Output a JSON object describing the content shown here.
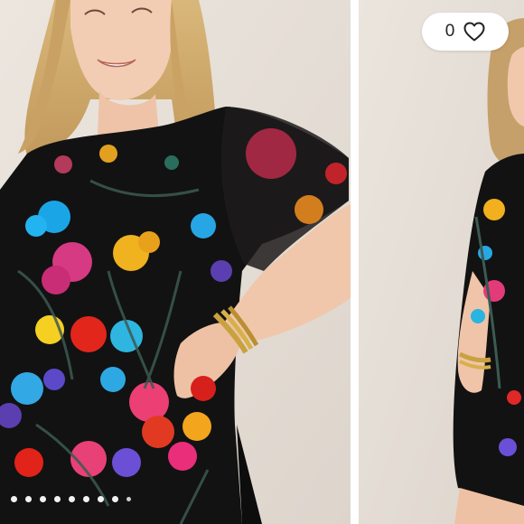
{
  "like": {
    "count": "0",
    "icon": "heart-outline-icon"
  },
  "carousel": {
    "slide_count": 9,
    "active_index": 0,
    "current_slide_alt": "",
    "next_slide_alt": ""
  },
  "colors": {
    "background": "#e9e3dd",
    "dress": "#111111",
    "dot": "#ffffff",
    "like_pill": "#ffffff"
  }
}
